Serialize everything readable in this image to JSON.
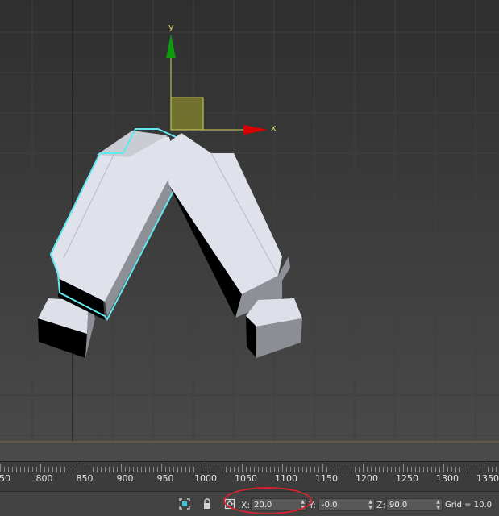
{
  "viewport": {
    "axis_labels": {
      "x": "x",
      "y": "y"
    },
    "colors": {
      "background": "#424242",
      "grid": "#4c4c4c",
      "x_axis": "#d80000",
      "y_axis": "#0f9a0f",
      "selection": "#63e8f0",
      "ground_line": "#7a6a3e"
    }
  },
  "timeline": {
    "ticks": [
      "50",
      "800",
      "850",
      "900",
      "950",
      "1000",
      "1050",
      "1100",
      "1150",
      "1200",
      "1250",
      "1300",
      "1350"
    ]
  },
  "statusbar": {
    "icons": [
      "isolate-selection-icon",
      "lock-selection-icon",
      "absolute-offset-mode-icon"
    ],
    "x_label": "X:",
    "x_value": "20.0",
    "y_label": "Y:",
    "y_value": "-0.0",
    "z_label": "Z:",
    "z_value": "90.0",
    "grid": "Grid = 10.0"
  },
  "highlight_color": "#d4222e"
}
